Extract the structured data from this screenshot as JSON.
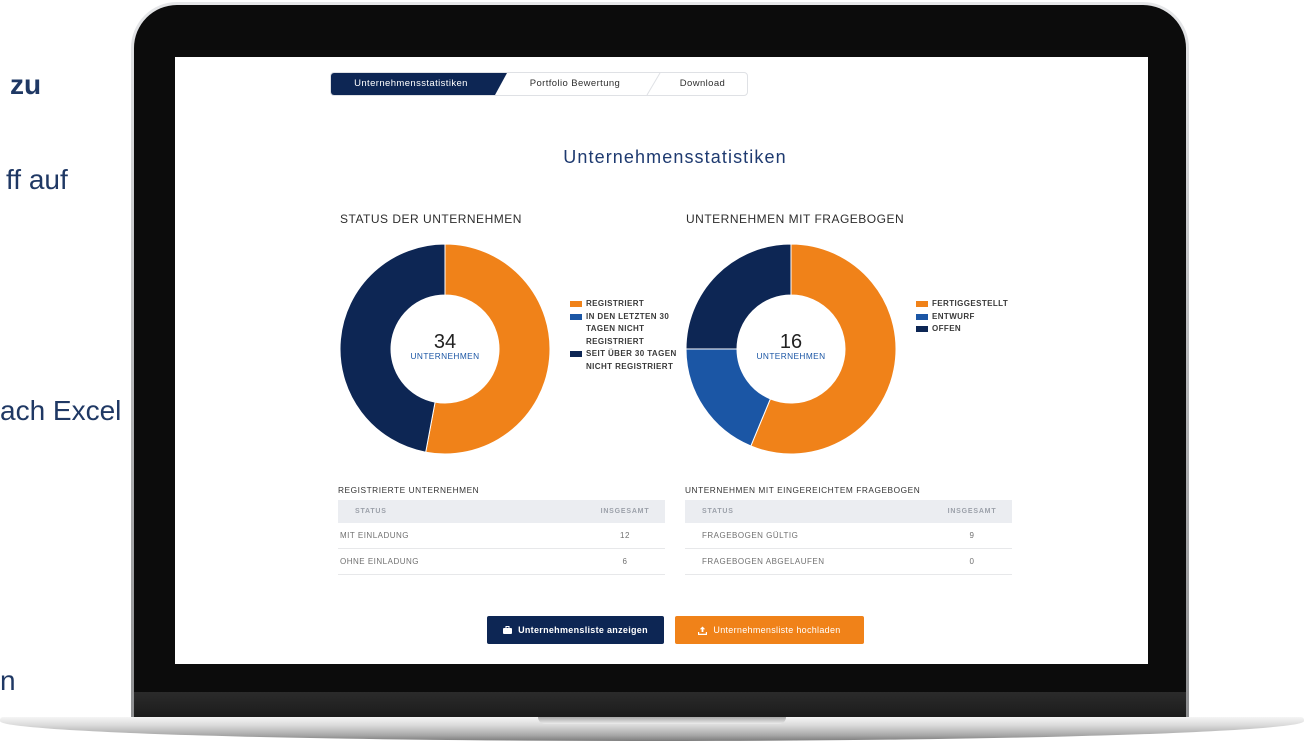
{
  "side_text": {
    "line1": "zu",
    "line2": "ff auf",
    "line3": "ach Excel",
    "line4": "n"
  },
  "tabs": [
    {
      "label": "Unternehmensstatistiken",
      "active": true
    },
    {
      "label": "Portfolio Bewertung",
      "active": false
    },
    {
      "label": "Download",
      "active": false
    }
  ],
  "page_title": "Unternehmensstatistiken",
  "colors": {
    "navy": "#0d2654",
    "orange": "#f08219",
    "blue": "#1b56a5",
    "title": "#1e3a70"
  },
  "chart_data": [
    {
      "type": "pie",
      "variant": "donut",
      "title": "STATUS DER UNTERNEHMEN",
      "center_value": "34",
      "center_label": "UNTERNEHMEN",
      "labels": [
        "REGISTRIERT",
        "IN DEN LETZTEN 30 TAGEN NICHT REGISTRIERT",
        "SEIT ÜBER 30 TAGEN NICHT REGISTRIERT"
      ],
      "values": [
        18,
        0,
        16
      ],
      "colors": [
        "#f08219",
        "#1b56a5",
        "#0d2654"
      ],
      "legend": "right"
    },
    {
      "type": "pie",
      "variant": "donut",
      "title": "UNTERNEHMEN MIT FRAGEBOGEN",
      "center_value": "16",
      "center_label": "UNTERNEHMEN",
      "labels": [
        "FERTIGGESTELLT",
        "ENTWURF",
        "OFFEN"
      ],
      "values": [
        9,
        3,
        4
      ],
      "colors": [
        "#f08219",
        "#1b56a5",
        "#0d2654"
      ],
      "legend": "right"
    }
  ],
  "tables": [
    {
      "caption": "REGISTRIERTE UNTERNEHMEN",
      "columns": [
        "STATUS",
        "INSGESAMT"
      ],
      "rows": [
        [
          "MIT EINLADUNG",
          "12"
        ],
        [
          "OHNE EINLADUNG",
          "6"
        ]
      ]
    },
    {
      "caption": "UNTERNEHMEN MIT EINGEREICHTEM FRAGEBOGEN",
      "columns": [
        "STATUS",
        "INSGESAMT"
      ],
      "rows": [
        [
          "FRAGEBOGEN GÜLTIG",
          "9"
        ],
        [
          "FRAGEBOGEN ABGELAUFEN",
          "0"
        ]
      ]
    }
  ],
  "buttons": {
    "show_list": {
      "label": "Unternehmensliste anzeigen",
      "icon": "briefcase-icon"
    },
    "upload_list": {
      "label": "Unternehmensliste hochladen",
      "icon": "upload-icon"
    }
  }
}
